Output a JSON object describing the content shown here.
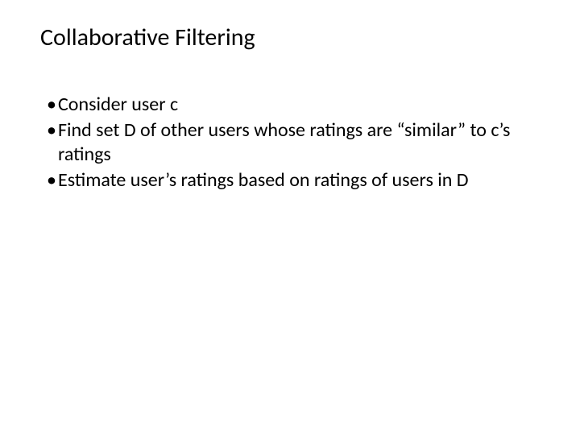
{
  "slide": {
    "title": "Collaborative Filtering",
    "bullets": [
      "Consider user c",
      "Find set D of other users whose ratings are “similar” to c’s ratings",
      "Estimate user’s ratings based on ratings of users in D"
    ],
    "bullet_marker": "•"
  }
}
